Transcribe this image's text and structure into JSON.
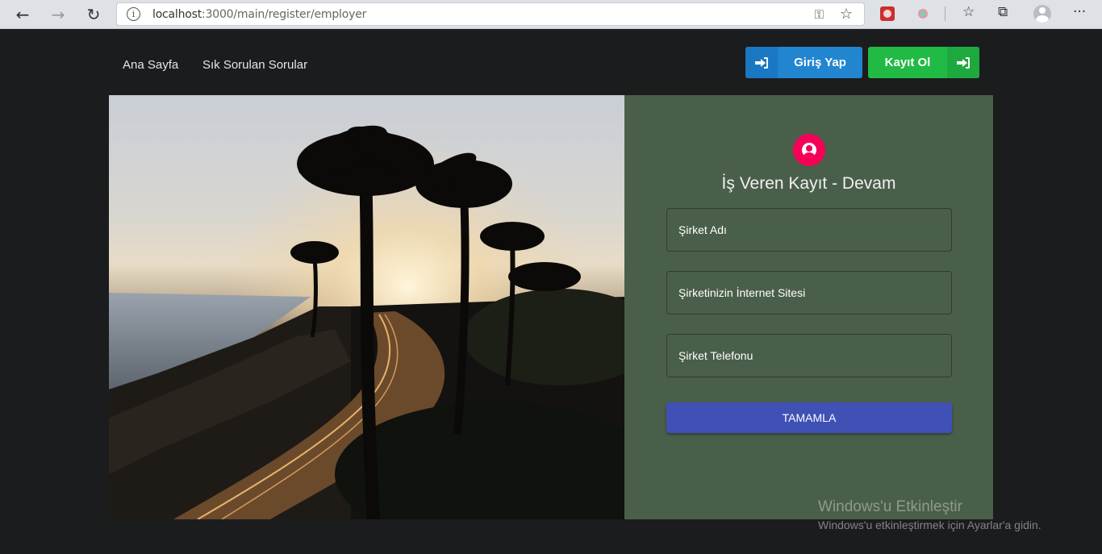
{
  "browser": {
    "url_host": "localhost",
    "url_rest": ":3000/main/register/employer",
    "back_icon": "arrow-left-icon",
    "forward_icon": "arrow-right-icon",
    "reload_icon": "reload-icon"
  },
  "nav": {
    "links": [
      "Ana Sayfa",
      "Sık Sorulan Sorular"
    ],
    "login_label": "Giriş Yap",
    "register_label": "Kayıt Ol"
  },
  "form": {
    "title": "İş Veren Kayıt - Devam",
    "fields": [
      "Şirket Adı",
      "Şirketinizin İnternet Sitesi",
      "Şirket Telefonu"
    ],
    "submit_label": "TAMAMLA",
    "accent_color": "#f50057",
    "button_color": "#3f51b5",
    "panel_color": "#4a5f49"
  },
  "watermark": {
    "line1": "Windows'u Etkinleştir",
    "line2": "Windows'u etkinleştirmek için Ayarlar'a gidin."
  }
}
